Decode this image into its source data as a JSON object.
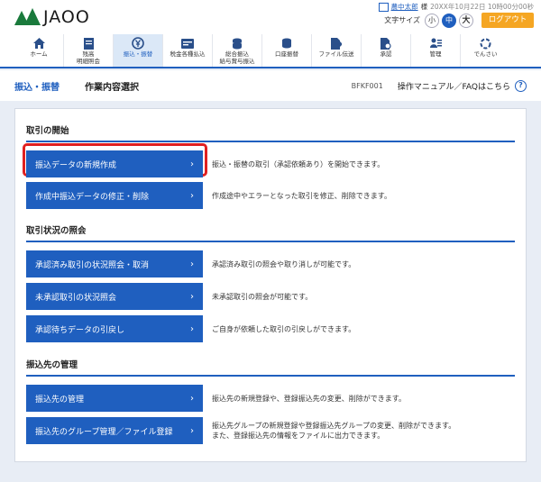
{
  "header": {
    "logo_text": "JAOO",
    "user_icon": "ｱｸﾃﾞ",
    "user_name": "農中太郎",
    "user_suffix": "様",
    "login_time": "20XX年10月22日 10時00分00秒",
    "font_size_label": "文字サイズ",
    "font_sizes": [
      "小",
      "中",
      "大"
    ],
    "logout_label": "ログアウト"
  },
  "nav": {
    "items": [
      {
        "label": "ホーム",
        "icon": "home-icon"
      },
      {
        "label": "残高\n明細照会",
        "icon": "passbook-icon"
      },
      {
        "label": "振込・振替",
        "icon": "yen-transfer-icon",
        "active": true
      },
      {
        "label": "税金各種払込",
        "icon": "tax-card-icon"
      },
      {
        "label": "総合振込\n給与賞与振込",
        "icon": "coin-stack-icon"
      },
      {
        "label": "口座振替",
        "icon": "account-transfer-icon"
      },
      {
        "label": "ファイル伝送",
        "icon": "file-transfer-icon"
      },
      {
        "label": "承認",
        "icon": "approve-icon"
      },
      {
        "label": "管理",
        "icon": "admin-icon"
      },
      {
        "label": "でんさい",
        "icon": "densai-icon"
      }
    ]
  },
  "titlebar": {
    "category": "振込・振替",
    "title": "作業内容選択",
    "screen_id": "BFKF001",
    "manual_link": "操作マニュアル／FAQはこちら",
    "help_symbol": "?"
  },
  "sections": [
    {
      "title": "取引の開始",
      "rows": [
        {
          "label": "振込データの新規作成",
          "desc": "振込・振替の取引（承認依頼あり）を開始できます。"
        },
        {
          "label": "作成中振込データの修正・削除",
          "desc": "作成途中やエラーとなった取引を修正、削除できます。"
        }
      ]
    },
    {
      "title": "取引状況の照会",
      "rows": [
        {
          "label": "承認済み取引の状況照会・取消",
          "desc": "承認済み取引の照会や取り消しが可能です。"
        },
        {
          "label": "未承認取引の状況照会",
          "desc": "未承認取引の照会が可能です。"
        },
        {
          "label": "承認待ちデータの引戻し",
          "desc": "ご自身が依頼した取引の引戻しができます。"
        }
      ]
    },
    {
      "title": "振込先の管理",
      "rows": [
        {
          "label": "振込先の管理",
          "desc": "振込先の新規登録や、登録振込先の変更、削除ができます。"
        },
        {
          "label": "振込先のグループ管理／ファイル登録",
          "desc": "振込先グループの新規登録や登録振込先グループの変更、削除ができます。",
          "desc2": "また、登録振込先の情報をファイルに出力できます。"
        }
      ]
    }
  ],
  "chevron": "›",
  "colors": {
    "primary": "#1f5fbf",
    "logout": "#f5a623",
    "highlight": "#e02020",
    "logo": "#1a7a3c"
  }
}
